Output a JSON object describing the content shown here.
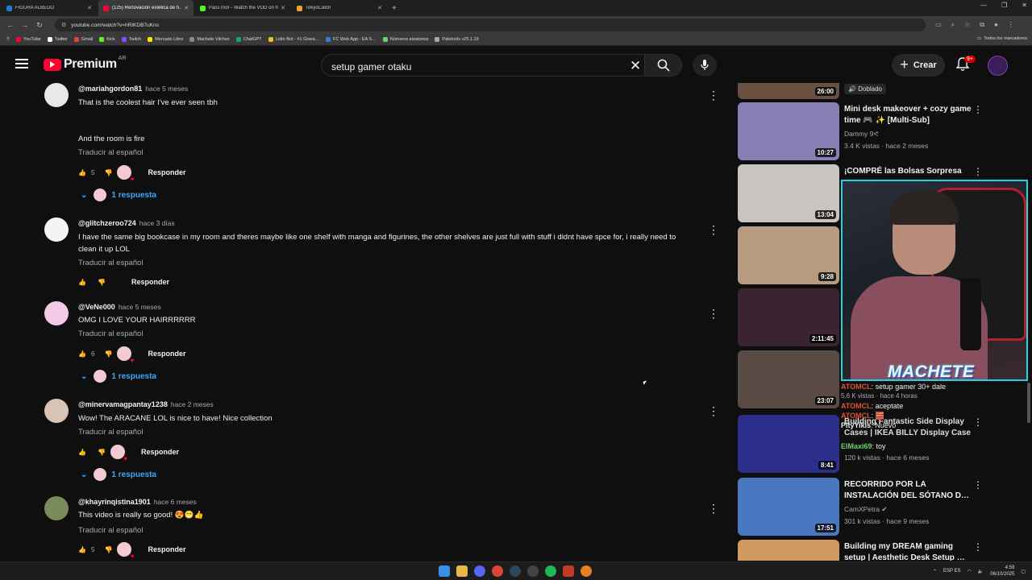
{
  "browser": {
    "tabs": [
      {
        "title": "FIGURA ALBEDO",
        "color": "#1f7ad6",
        "active": false
      },
      {
        "title": "(125) Renovación estética de h…",
        "color": "#ff0033",
        "active": true
      },
      {
        "title": "PassThor - Watch the VOD on h…",
        "color": "#53fc18",
        "active": false
      },
      {
        "title": "TokyoCatch",
        "color": "#f0a030",
        "active": false
      }
    ],
    "new_tab": "+",
    "url": "youtube.com/watch?v=hRIKDB7uKns",
    "bookmarks": [
      "YouTube",
      "Twitter",
      "Gmail",
      "Kick",
      "Twitch",
      "Mercado Libre",
      "Machete Vilches",
      "ChatGPT",
      "Lotto Bot - #1 Givea…",
      "FC Web App - EA S…",
      "Números aleatorios",
      "Paletools v25.1.19"
    ],
    "bookmark_colors": [
      "#ff0033",
      "#ffffff",
      "#ea4335",
      "#53fc18",
      "#9146ff",
      "#ffe600",
      "#888888",
      "#10a37f",
      "#f0c030",
      "#3a7bd5",
      "#6bd46b",
      "#aaaaaa"
    ],
    "all_bookmarks": "Todos los marcadores"
  },
  "header": {
    "logo_text": "Premium",
    "country": "AR",
    "search_query": "setup gamer otaku",
    "create_label": "Crear",
    "notif_badge": "9+"
  },
  "comments": [
    {
      "author": "@mariahgordon81",
      "time": "hace 5 meses",
      "text": "That is the coolest hair I've ever seen tbh\n\n\nAnd the room is fire",
      "translate": "Traducir al español",
      "likes": "5",
      "reply_label": "Responder",
      "replies": "1 respuesta",
      "avatar": "#e8e8e8"
    },
    {
      "author": "@glitchzeroo724",
      "time": "hace 3 días",
      "text": "I have the same big bookcase in my room and theres maybe like one shelf with manga and figurines, the other shelves are just full with stuff i didnt have spce for, i really need to clean it up LOL",
      "translate": "Traducir al español",
      "likes": "",
      "reply_label": "Responder",
      "replies": "",
      "avatar": "#f4f4f4"
    },
    {
      "author": "@VeNe000",
      "time": "hace 5 meses",
      "text": "OMG I LOVE YOUR HAIRRRRRR",
      "translate": "Traducir al español",
      "likes": "6",
      "reply_label": "Responder",
      "replies": "1 respuesta",
      "avatar": "#f3c9e6"
    },
    {
      "author": "@minervamagpantay1238",
      "time": "hace 2 meses",
      "text": "Wow! The ARACANE LOL is nice to have! Nice collection",
      "translate": "Traducir al español",
      "likes": "",
      "reply_label": "Responder",
      "replies": "1 respuesta",
      "avatar": "#d9c3b5"
    },
    {
      "author": "@khayrinqistina1901",
      "time": "hace 6 meses",
      "text": "This video is really so good! 😍😁👍",
      "translate": "Traducir al español",
      "likes": "5",
      "reply_label": "Responder",
      "replies": "",
      "avatar": "#7a8a5a"
    }
  ],
  "sidebar": {
    "top_duration": "26:00",
    "top_tag": "Doblado",
    "videos": [
      {
        "title": "Mini desk makeover + cozy game time 🎮 ✨ [Multi-Sub]",
        "channel": "Dammy 9ᕙ",
        "meta": "3.4 K vistas · hace 2 meses",
        "duration": "10:27",
        "thumb": "#8a7fb5"
      },
      {
        "title": "¡COMPRÉ las Bolsas Sorpresa",
        "channel": "",
        "meta": "",
        "duration": "13:04",
        "thumb": "#c9c4c0"
      },
      {
        "title": "",
        "channel": "",
        "meta": "",
        "duration": "9:28",
        "thumb": "#b79a80"
      },
      {
        "title": "",
        "channel": "",
        "meta": "",
        "duration": "2:11:45",
        "thumb": "#3a2430"
      },
      {
        "title": "",
        "channel": "",
        "meta": "",
        "duration": "23:07",
        "thumb": "#5a4a44"
      },
      {
        "title": "Building Fantastic Side Display Cases | IKEA BILLY Display Case",
        "channel": "Nuevo",
        "meta": "120 k vistas · hace 6 meses",
        "duration": "8:41",
        "thumb": "#2b2e8a"
      },
      {
        "title": "RECORRIDO POR LA INSTALACIÓN DEL SÓTANO D…",
        "channel": "CamXPetra",
        "meta": "301 k vistas · hace 9 meses",
        "duration": "17:51",
        "thumb": "#4a78c0"
      },
      {
        "title": "Building my DREAM gaming setup | Aesthetic Desk Setup …",
        "channel": "",
        "meta": "",
        "duration": "",
        "thumb": "#d09a60"
      }
    ]
  },
  "overlay": {
    "streamer_name": "MACHETE",
    "chat": [
      {
        "user": "ATOMCL",
        "msg": ": setup gamer 30+ dale"
      },
      {
        "user": "",
        "msg": "5.6 K vistas · hace 4 horas"
      },
      {
        "user": "ATOMCL",
        "msg": ": aceptate"
      },
      {
        "user": "ATOMCL",
        "msg": ": 🧱"
      },
      {
        "user": "PityYikis",
        "msg": ": Nuevo"
      },
      {
        "user": "ElMaxi69",
        "msg": ": toy"
      }
    ]
  },
  "taskbar": {
    "lang": "ESP ES",
    "time": "4:59",
    "date": "06/10/2025"
  }
}
